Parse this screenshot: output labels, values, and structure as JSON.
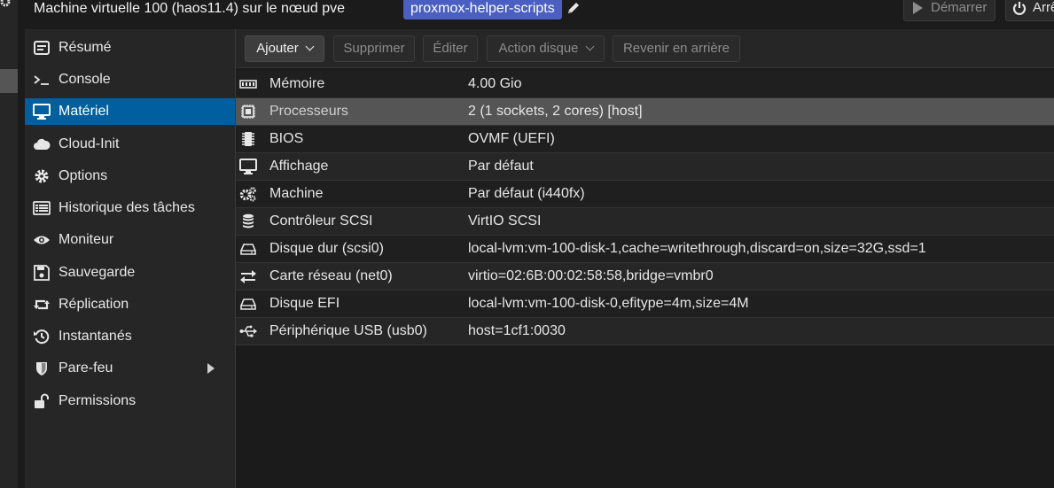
{
  "header": {
    "vm_title": "Machine virtuelle 100 (haos11.4) sur le nœud pve",
    "tag": "proxmox-helper-scripts",
    "start_label": "Démarrer",
    "stop_label": "Arrê"
  },
  "sidebar": {
    "items": [
      {
        "label": "Résumé",
        "icon": "dashboard-icon"
      },
      {
        "label": "Console",
        "icon": "terminal-icon"
      },
      {
        "label": "Matériel",
        "icon": "monitor-icon",
        "active": true
      },
      {
        "label": "Cloud-Init",
        "icon": "cloud-icon"
      },
      {
        "label": "Options",
        "icon": "gear-icon"
      },
      {
        "label": "Historique des tâches",
        "icon": "list-icon"
      },
      {
        "label": "Moniteur",
        "icon": "eye-icon"
      },
      {
        "label": "Sauvegarde",
        "icon": "floppy-icon"
      },
      {
        "label": "Réplication",
        "icon": "retweet-icon"
      },
      {
        "label": "Instantanés",
        "icon": "history-icon"
      },
      {
        "label": "Pare-feu",
        "icon": "shield-icon"
      },
      {
        "label": "Permissions",
        "icon": "unlock-icon"
      }
    ]
  },
  "toolbar": {
    "add": "Ajouter",
    "delete": "Supprimer",
    "edit": "Éditer",
    "disk_action": "Action disque",
    "revert": "Revenir en arrière"
  },
  "hardware": {
    "rows": [
      {
        "name": "Mémoire",
        "value": "4.00 Gio",
        "icon": "memory-icon"
      },
      {
        "name": "Processeurs",
        "value": "2 (1 sockets, 2 cores) [host]",
        "icon": "cpu-icon"
      },
      {
        "name": "BIOS",
        "value": "OVMF (UEFI)",
        "icon": "microchip-icon"
      },
      {
        "name": "Affichage",
        "value": "Par défaut",
        "icon": "desktop-icon"
      },
      {
        "name": "Machine",
        "value": "Par défaut (i440fx)",
        "icon": "cogs-icon"
      },
      {
        "name": "Contrôleur SCSI",
        "value": "VirtIO SCSI",
        "icon": "database-icon"
      },
      {
        "name": "Disque dur (scsi0)",
        "value": "local-lvm:vm-100-disk-1,cache=writethrough,discard=on,size=32G,ssd=1",
        "icon": "hdd-icon"
      },
      {
        "name": "Carte réseau (net0)",
        "value": "virtio=02:6B:00:02:58:58,bridge=vmbr0",
        "icon": "exchange-icon"
      },
      {
        "name": "Disque EFI",
        "value": "local-lvm:vm-100-disk-0,efitype=4m,size=4M",
        "icon": "hdd-icon"
      },
      {
        "name": "Périphérique USB (usb0)",
        "value": "host=1cf1:0030",
        "icon": "usb-icon"
      }
    ]
  }
}
